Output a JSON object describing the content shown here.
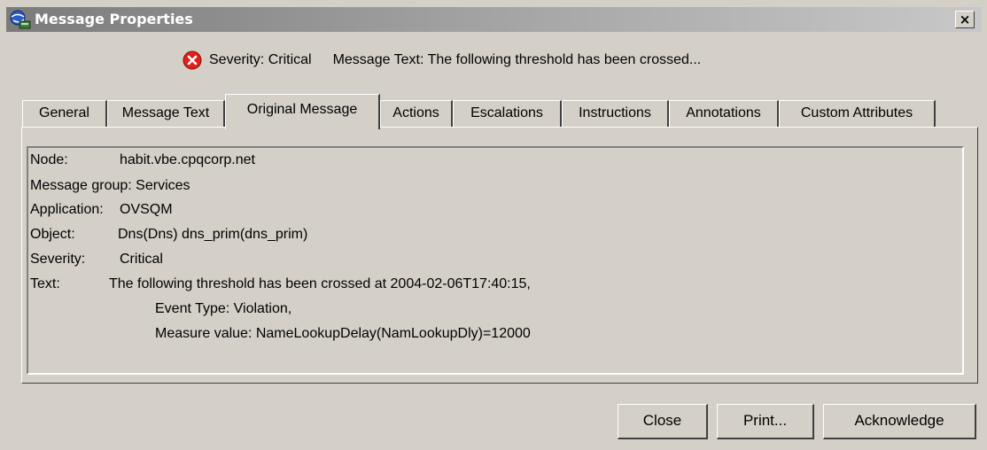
{
  "window": {
    "title": "Message Properties",
    "close_glyph": "×"
  },
  "summary": {
    "severity": "Severity: Critical",
    "message": "Message Text: The following threshold has been crossed..."
  },
  "tabs": [
    {
      "label": "General"
    },
    {
      "label": "Message Text"
    },
    {
      "label": "Original Message",
      "active": true
    },
    {
      "label": "Actions"
    },
    {
      "label": "Escalations"
    },
    {
      "label": "Instructions"
    },
    {
      "label": "Annotations"
    },
    {
      "label": "Custom Attributes"
    }
  ],
  "details": {
    "node_label": "Node:",
    "node_value": "habit.vbe.cpqcorp.net",
    "group": "Message group: Services",
    "app_label": "Application:",
    "app_value": "OVSQM",
    "object_label": "Object:",
    "object_value": "Dns(Dns) dns_prim(dns_prim)",
    "severity_label": "Severity:",
    "severity_value": "Critical",
    "text_label": "Text:",
    "text_line1": "The following threshold has been crossed at 2004-02-06T17:40:15,",
    "text_line2": "Event Type: Violation,",
    "text_line3": "Measure value: NameLookupDelay(NamLookupDly)=12000"
  },
  "buttons": {
    "close": "Close",
    "print": "Print...",
    "acknowledge": "Acknowledge"
  },
  "colors": {
    "dialog_bg": "#d4d0c8",
    "critical": "#e0201a"
  },
  "icons": {
    "app": "app-globe-icon",
    "severity": "critical-x-icon"
  }
}
